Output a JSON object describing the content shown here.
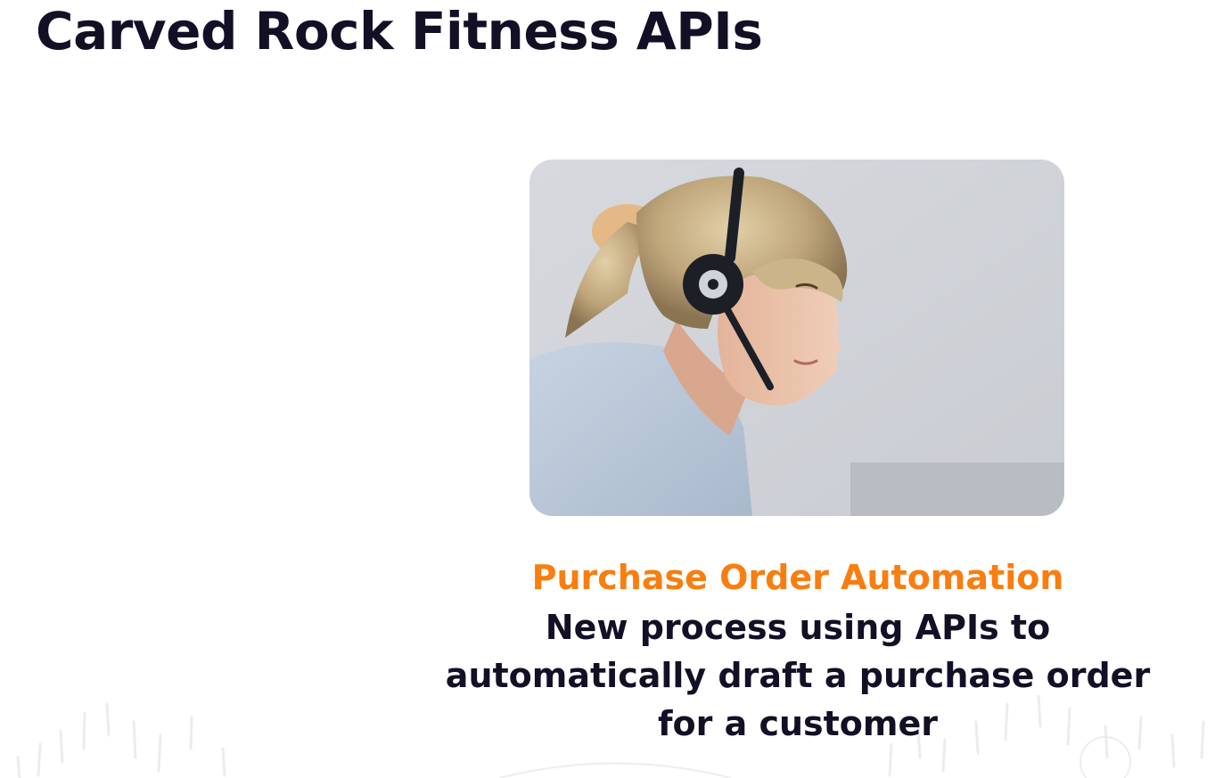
{
  "slide": {
    "title": "Carved Rock Fitness APIs"
  },
  "photo": {
    "subject": "woman-with-headset-photo"
  },
  "caption": {
    "heading": "Purchase Order Automation",
    "lines": [
      "New process using APIs to",
      "automatically draft a purchase order",
      "for a customer"
    ]
  },
  "colors": {
    "title": "#130f25",
    "accent": "#f97d0f",
    "background": "#ffffff"
  }
}
